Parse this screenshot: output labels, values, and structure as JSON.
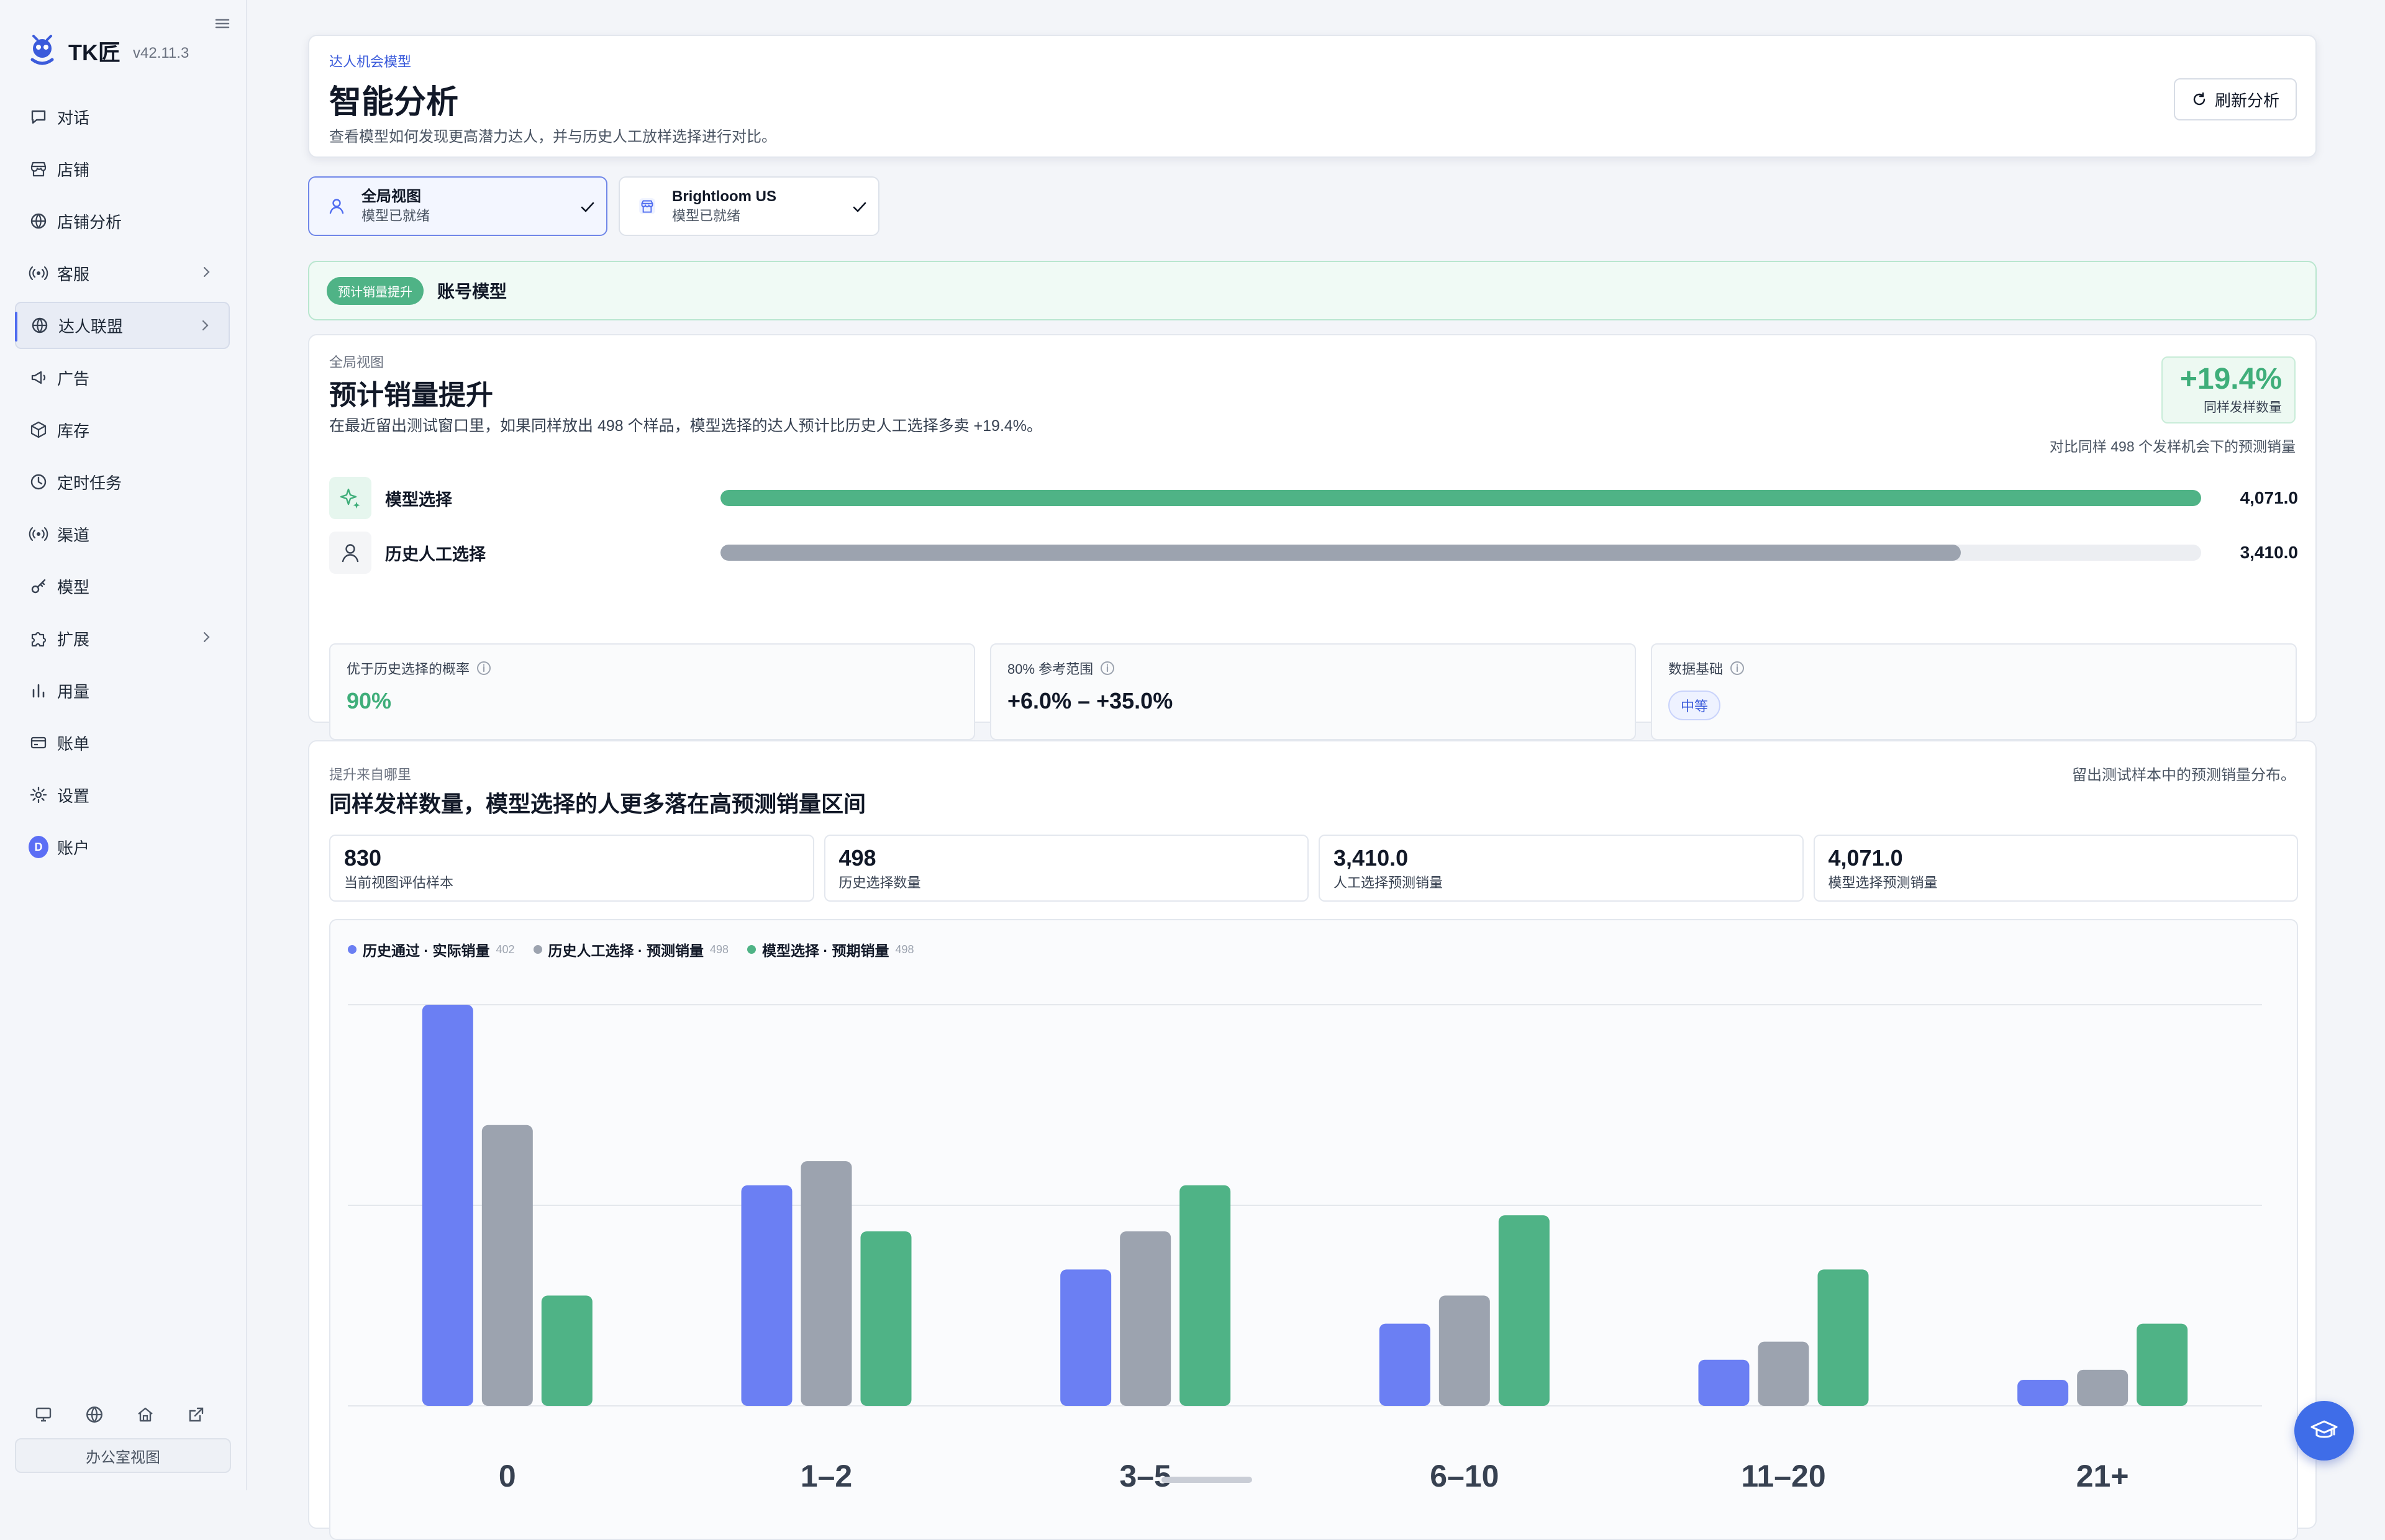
{
  "brand": {
    "name": "TK匠",
    "version": "v42.11.3"
  },
  "nav": [
    {
      "label": "对话",
      "icon": "chat-icon"
    },
    {
      "label": "店铺",
      "icon": "store-icon"
    },
    {
      "label": "店铺分析",
      "icon": "globe-icon"
    },
    {
      "label": "客服",
      "icon": "broadcast-icon",
      "expandable": true
    },
    {
      "label": "达人联盟",
      "icon": "globe-icon",
      "expandable": true,
      "active": true
    },
    {
      "label": "广告",
      "icon": "megaphone-icon"
    },
    {
      "label": "库存",
      "icon": "box-icon"
    },
    {
      "label": "定时任务",
      "icon": "clock-icon"
    },
    {
      "label": "渠道",
      "icon": "broadcast-icon"
    },
    {
      "label": "模型",
      "icon": "key-icon"
    },
    {
      "label": "扩展",
      "icon": "puzzle-icon",
      "expandable": true
    },
    {
      "label": "用量",
      "icon": "bar-chart-icon"
    },
    {
      "label": "账单",
      "icon": "card-icon"
    },
    {
      "label": "设置",
      "icon": "gear-icon"
    },
    {
      "label": "账户",
      "icon": "avatar",
      "avatar_letter": "D"
    }
  ],
  "sidebar_footer": {
    "office_view": "办公室视图"
  },
  "header": {
    "eyebrow": "达人机会模型",
    "title": "智能分析",
    "subtitle": "查看模型如何发现更高潜力达人，并与历史人工放样选择进行对比。",
    "refresh_label": "刷新分析"
  },
  "scopes": [
    {
      "title": "全局视图",
      "status": "模型已就绪",
      "selected": true
    },
    {
      "title": "Brightloom US",
      "status": "模型已就绪",
      "selected": false
    }
  ],
  "banner": {
    "pill": "预计销量提升",
    "text": "账号模型"
  },
  "uplift": {
    "eyebrow": "全局视图",
    "title": "预计销量提升",
    "description": "在最近留出测试窗口里，如果同样放出 498 个样品，模型选择的达人预计比历史人工选择多卖 +19.4%。",
    "badge_value": "+19.4%",
    "badge_label": "同样发样数量",
    "compare_note": "对比同样 498 个发样机会下的预测销量",
    "rows": [
      {
        "label": "模型选择",
        "value_text": "4,071.0",
        "value": 4071.0,
        "color": "#4fb386"
      },
      {
        "label": "历史人工选择",
        "value_text": "3,410.0",
        "value": 3410.0,
        "color": "#9ca3af"
      }
    ],
    "metrics": [
      {
        "label": "优于历史选择的概率",
        "value": "90%",
        "color": "#3fae7a"
      },
      {
        "label": "80% 参考范围",
        "value": "+6.0% – +35.0%",
        "color": "#111827"
      },
      {
        "label": "数据基础",
        "chip": "中等"
      }
    ]
  },
  "distribution": {
    "eyebrow": "提升来自哪里",
    "title": "同样发样数量，模型选择的人更多落在高预测销量区间",
    "note": "留出测试样本中的预测销量分布。",
    "stats": [
      {
        "value": "830",
        "label": "当前视图评估样本"
      },
      {
        "value": "498",
        "label": "历史选择数量"
      },
      {
        "value": "3,410.0",
        "label": "人工选择预测销量"
      },
      {
        "value": "4,071.0",
        "label": "模型选择预测销量"
      }
    ]
  },
  "colors": {
    "blue": "#6b7ff3",
    "gray": "#9ca3af",
    "green": "#4fb386",
    "accent": "#3b5bdb"
  },
  "chart_data": {
    "type": "bar",
    "categories": [
      "0",
      "1–2",
      "3–5",
      "6–10",
      "11–20",
      "21+"
    ],
    "series": [
      {
        "name": "历史通过 · 实际销量",
        "count": "402",
        "color": "#6b7ff3",
        "values": [
          200,
          110,
          68,
          41,
          23,
          13
        ]
      },
      {
        "name": "历史人工选择 · 预测销量",
        "count": "498",
        "color": "#9ca3af",
        "values": [
          140,
          122,
          87,
          55,
          32,
          18
        ]
      },
      {
        "name": "模型选择 · 预期销量",
        "count": "498",
        "color": "#4fb386",
        "values": [
          55,
          87,
          110,
          95,
          68,
          41
        ]
      }
    ],
    "ylim": [
      0,
      200
    ],
    "grid": true,
    "legend": "top-left"
  }
}
